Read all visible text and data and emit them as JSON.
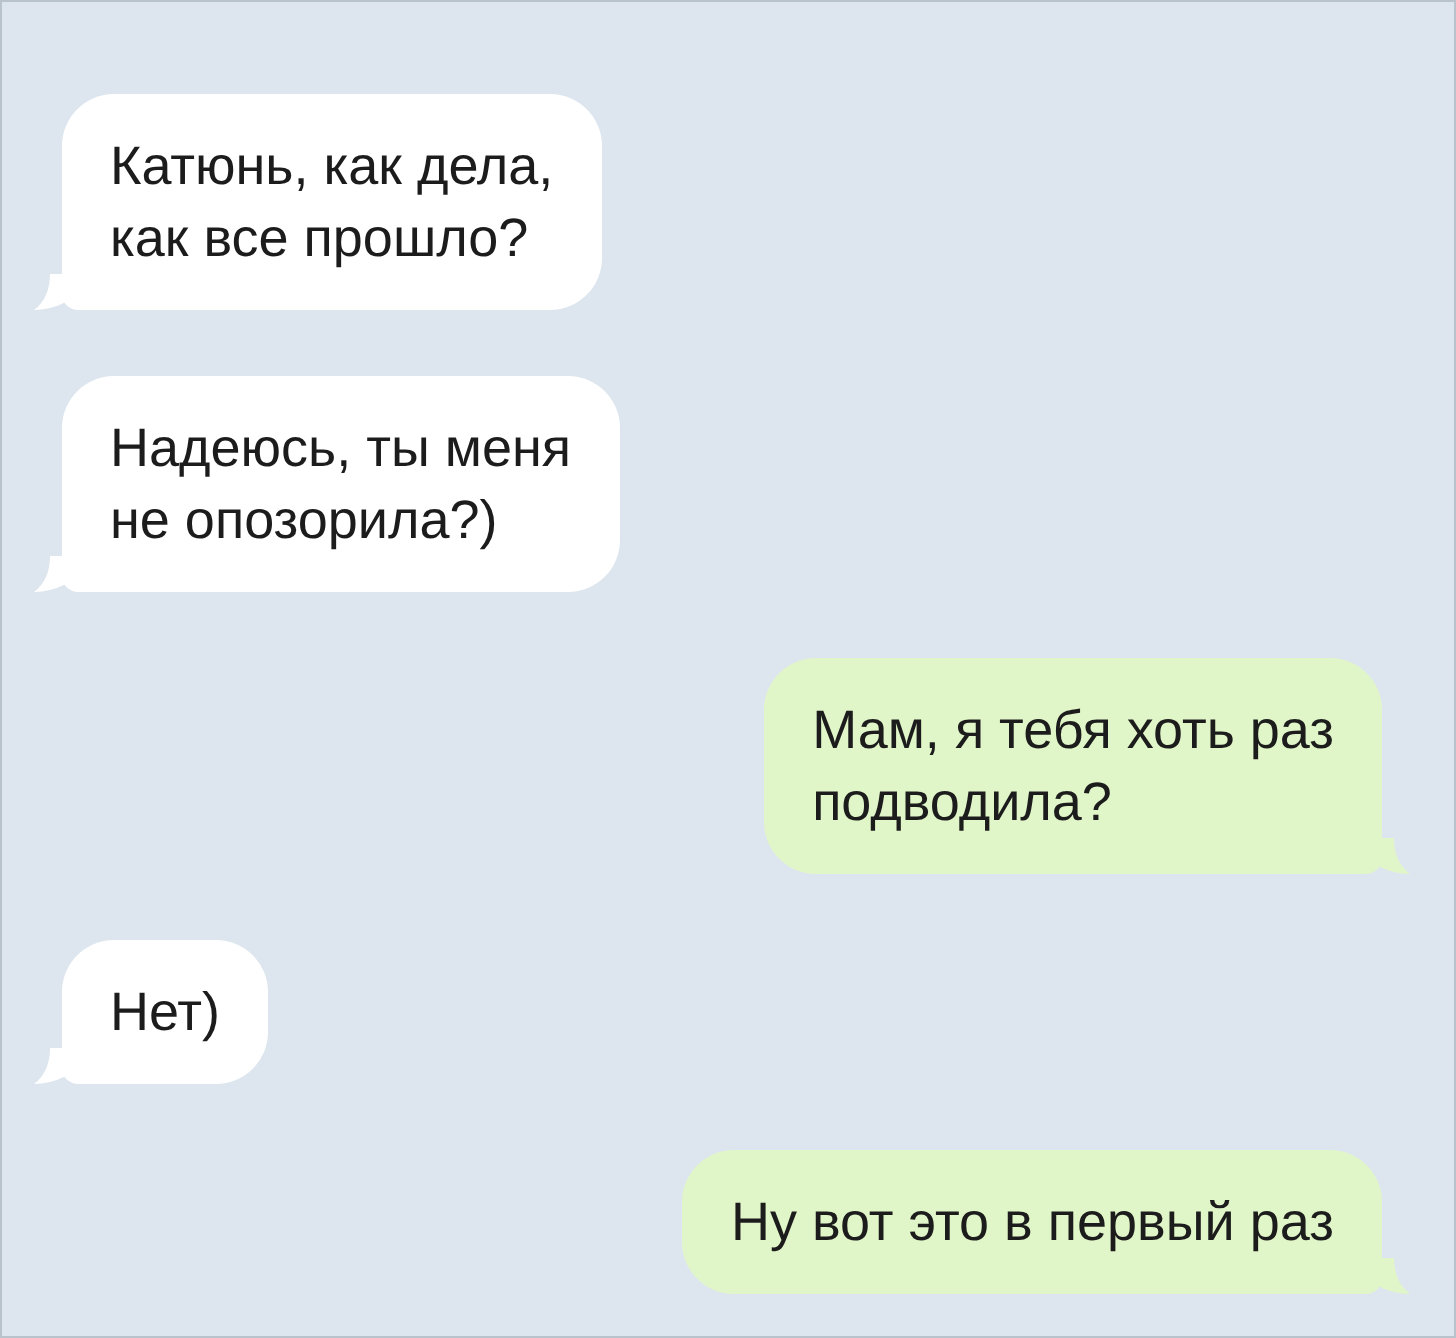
{
  "messages": [
    {
      "kind": "incoming",
      "text": "Катюнь, как дела,\nкак все прошло?"
    },
    {
      "kind": "incoming",
      "text": "Надеюсь, ты меня\nне опозорила?)"
    },
    {
      "kind": "outgoing",
      "text": "Мам, я тебя хоть раз\nподводила?"
    },
    {
      "kind": "incoming",
      "text": "Нет)"
    },
    {
      "kind": "outgoing",
      "text": "Ну вот это в первый раз"
    }
  ]
}
